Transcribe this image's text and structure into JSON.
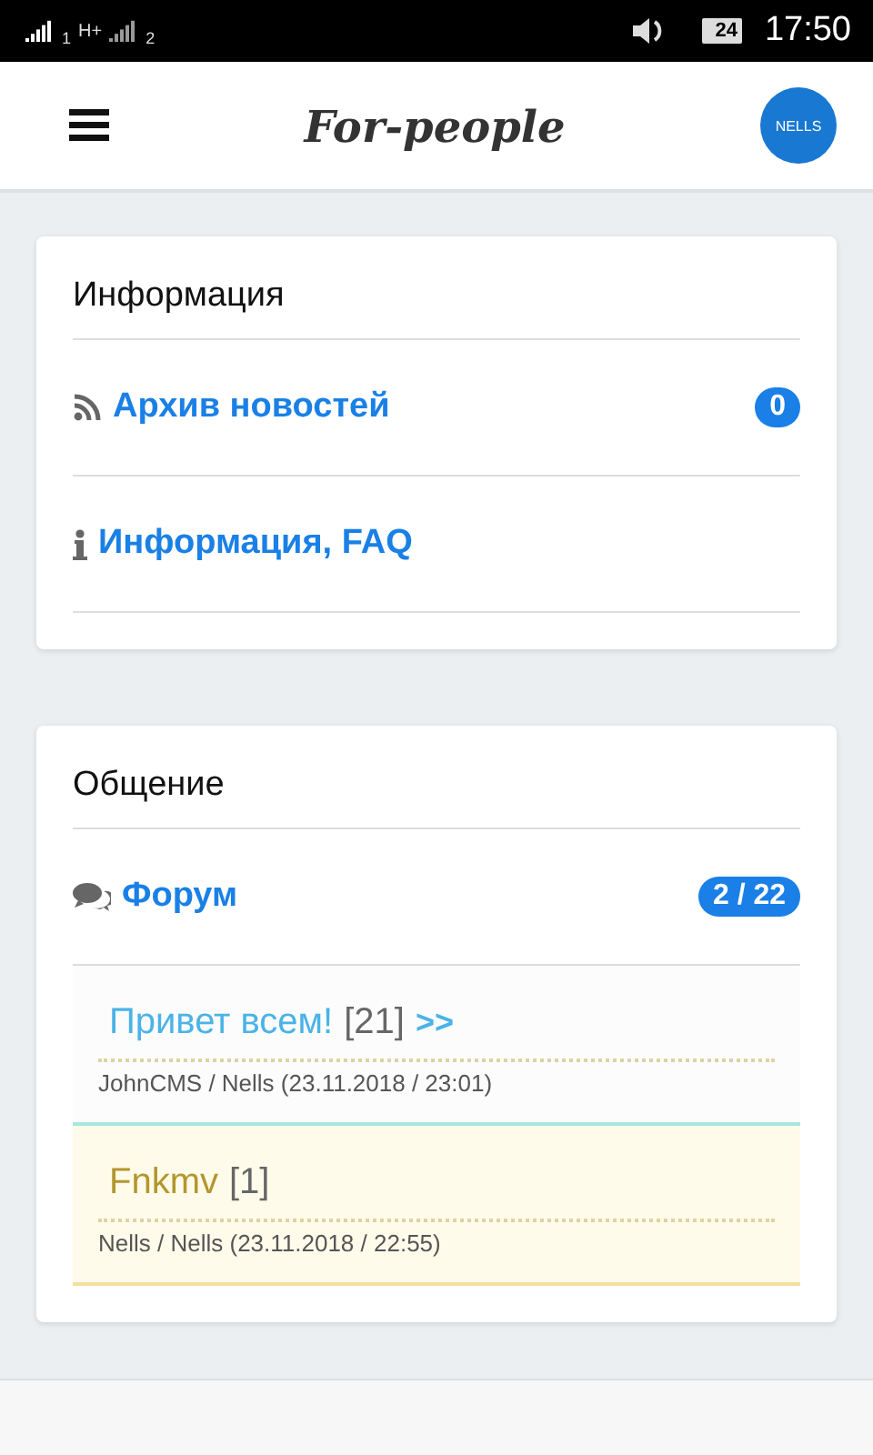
{
  "status_bar": {
    "sim_1": "1",
    "network": "H+",
    "sim_2": "2",
    "battery": "24",
    "time": "17:50"
  },
  "header": {
    "title": "For-people",
    "avatar": "NELLS"
  },
  "sections": [
    {
      "title": "Информация",
      "items": [
        {
          "kind": "rss",
          "label": "Архив новостей",
          "count": "0"
        },
        {
          "kind": "info",
          "label": "Информация, FAQ"
        }
      ]
    },
    {
      "title": "Общение",
      "items": [
        {
          "kind": "comments",
          "label": "Форум",
          "count": "2 / 22"
        }
      ],
      "topics": [
        {
          "kind": "normal",
          "title": "Привет всем!",
          "count": "[21]",
          "more": ">>",
          "meta": "JohnCMS / Nells (23.11.2018 / 23:01)"
        },
        {
          "kind": "highlighted",
          "title": "Fnkmv",
          "count": "[1]",
          "meta": "Nells / Nells (23.11.2018 / 22:55)"
        }
      ]
    }
  ]
}
